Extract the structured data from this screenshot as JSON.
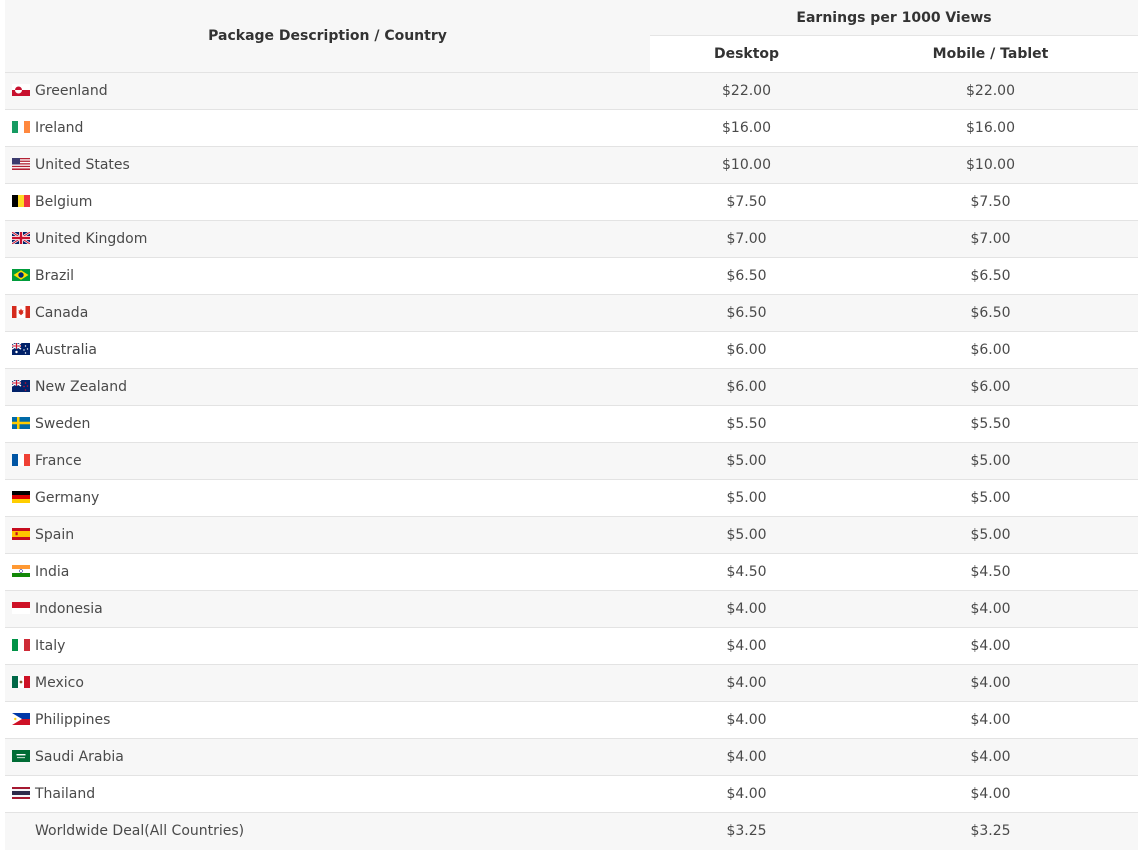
{
  "header": {
    "package_label": "Package Description / Country",
    "earnings_label": "Earnings per 1000 Views",
    "desktop_label": "Desktop",
    "mobile_label": "Mobile / Tablet"
  },
  "rows": [
    {
      "country": "Greenland",
      "flag": "greenland-flag-icon",
      "desktop": "$22.00",
      "mobile": "$22.00"
    },
    {
      "country": "Ireland",
      "flag": "ireland-flag-icon",
      "desktop": "$16.00",
      "mobile": "$16.00"
    },
    {
      "country": "United States",
      "flag": "united-states-flag-icon",
      "desktop": "$10.00",
      "mobile": "$10.00"
    },
    {
      "country": "Belgium",
      "flag": "belgium-flag-icon",
      "desktop": "$7.50",
      "mobile": "$7.50"
    },
    {
      "country": "United Kingdom",
      "flag": "united-kingdom-flag-icon",
      "desktop": "$7.00",
      "mobile": "$7.00"
    },
    {
      "country": "Brazil",
      "flag": "brazil-flag-icon",
      "desktop": "$6.50",
      "mobile": "$6.50"
    },
    {
      "country": "Canada",
      "flag": "canada-flag-icon",
      "desktop": "$6.50",
      "mobile": "$6.50"
    },
    {
      "country": "Australia",
      "flag": "australia-flag-icon",
      "desktop": "$6.00",
      "mobile": "$6.00"
    },
    {
      "country": "New Zealand",
      "flag": "new-zealand-flag-icon",
      "desktop": "$6.00",
      "mobile": "$6.00"
    },
    {
      "country": "Sweden",
      "flag": "sweden-flag-icon",
      "desktop": "$5.50",
      "mobile": "$5.50"
    },
    {
      "country": "France",
      "flag": "france-flag-icon",
      "desktop": "$5.00",
      "mobile": "$5.00"
    },
    {
      "country": "Germany",
      "flag": "germany-flag-icon",
      "desktop": "$5.00",
      "mobile": "$5.00"
    },
    {
      "country": "Spain",
      "flag": "spain-flag-icon",
      "desktop": "$5.00",
      "mobile": "$5.00"
    },
    {
      "country": "India",
      "flag": "india-flag-icon",
      "desktop": "$4.50",
      "mobile": "$4.50"
    },
    {
      "country": "Indonesia",
      "flag": "indonesia-flag-icon",
      "desktop": "$4.00",
      "mobile": "$4.00"
    },
    {
      "country": "Italy",
      "flag": "italy-flag-icon",
      "desktop": "$4.00",
      "mobile": "$4.00"
    },
    {
      "country": "Mexico",
      "flag": "mexico-flag-icon",
      "desktop": "$4.00",
      "mobile": "$4.00"
    },
    {
      "country": "Philippines",
      "flag": "philippines-flag-icon",
      "desktop": "$4.00",
      "mobile": "$4.00"
    },
    {
      "country": "Saudi Arabia",
      "flag": "saudi-arabia-flag-icon",
      "desktop": "$4.00",
      "mobile": "$4.00"
    },
    {
      "country": "Thailand",
      "flag": "thailand-flag-icon",
      "desktop": "$4.00",
      "mobile": "$4.00"
    },
    {
      "country": "Worldwide Deal(All Countries)",
      "flag": "",
      "desktop": "$3.25",
      "mobile": "$3.25"
    }
  ]
}
